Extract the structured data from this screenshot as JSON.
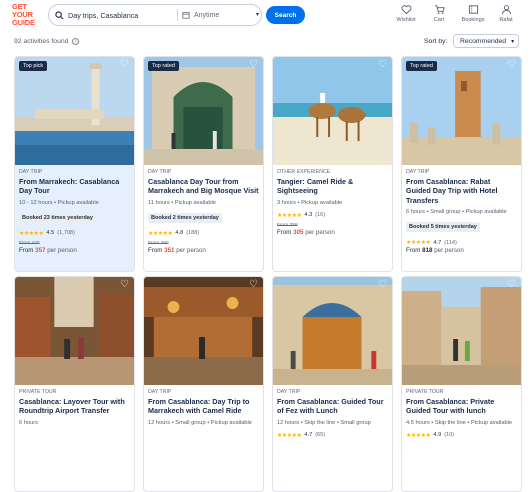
{
  "logo": [
    "GET",
    "YOUR",
    "GUIDE"
  ],
  "search": {
    "query": "Day trips, Casablanca",
    "date": "Anytime",
    "button": "Search"
  },
  "nav": [
    {
      "label": "Wishlist",
      "icon": "heart-icon"
    },
    {
      "label": "Cart",
      "icon": "cart-icon"
    },
    {
      "label": "Bookings",
      "icon": "ticket-icon"
    },
    {
      "label": "Rafat",
      "icon": "user-icon"
    }
  ],
  "results": {
    "count": "92 activities found",
    "sort_label": "Sort by:",
    "sort_value": "Recommended"
  },
  "cards": [
    {
      "badge": "Top pick",
      "category": "DAY TRIP",
      "title": "From Marrakech: Casablanca Day Tour",
      "meta": "10 - 12 hours • Pickup available",
      "booked": "Booked 23 times yesterday",
      "rating": "4.5",
      "count": "(1,708)",
      "was": "From 420",
      "price_prefix": "From",
      "price": "357",
      "price_suffix": "per person",
      "highlight": true
    },
    {
      "badge": "Top rated",
      "category": "DAY TRIP",
      "title": "Casablanca Day Tour from Marrakech and Big Mosque Visit",
      "meta": "11 hours • Pickup available",
      "booked": "Booked 2 times yesterday",
      "rating": "4.8",
      "count": "(188)",
      "was": "From 390",
      "price_prefix": "From",
      "price": "351",
      "price_suffix": "per person",
      "highlight": false
    },
    {
      "badge": "",
      "category": "OTHER EXPERIENCE",
      "title": "Tangier: Camel Ride & Sightseeing",
      "meta": "3 hours • Pickup available",
      "booked": "",
      "rating": "4.3",
      "count": "(16)",
      "was": "From 359",
      "price_prefix": "From",
      "price": "305",
      "price_suffix": "per person",
      "highlight": false
    },
    {
      "badge": "Top rated",
      "category": "DAY TRIP",
      "title": "From Casablanca: Rabat Guided Day Trip with Hotel Transfers",
      "meta": "6 hours • Small group • Pickup available",
      "booked": "Booked 5 times yesterday",
      "rating": "4.7",
      "count": "(114)",
      "was": "",
      "price_prefix": "From",
      "price": "818",
      "price_suffix": "per person",
      "highlight": false
    },
    {
      "badge": "",
      "category": "PRIVATE TOUR",
      "title": "Casablanca: Layover Tour with Roundtrip Airport Transfer",
      "meta": "6 hours",
      "booked": "",
      "rating": "",
      "count": "",
      "was": "",
      "price_prefix": "",
      "price": "",
      "price_suffix": "",
      "highlight": false
    },
    {
      "badge": "",
      "category": "DAY TRIP",
      "title": "From Casablanca: Day Trip to Marrakech with Camel Ride",
      "meta": "12 hours • Small group • Pickup available",
      "booked": "",
      "rating": "",
      "count": "",
      "was": "",
      "price_prefix": "",
      "price": "",
      "price_suffix": "",
      "highlight": false
    },
    {
      "badge": "",
      "category": "DAY TRIP",
      "title": "From Casablanca: Guided Tour of Fez with Lunch",
      "meta": "12 hours • Skip the line • Small group",
      "booked": "",
      "rating": "4.7",
      "count": "(65)",
      "was": "",
      "price_prefix": "",
      "price": "",
      "price_suffix": "",
      "highlight": false
    },
    {
      "badge": "",
      "category": "PRIVATE TOUR",
      "title": "From Casablanca: Private Guided Tour with lunch",
      "meta": "4.5 hours • Skip the line • Pickup available",
      "booked": "",
      "rating": "4.9",
      "count": "(10)",
      "was": "",
      "price_prefix": "",
      "price": "",
      "price_suffix": "",
      "highlight": false
    }
  ]
}
